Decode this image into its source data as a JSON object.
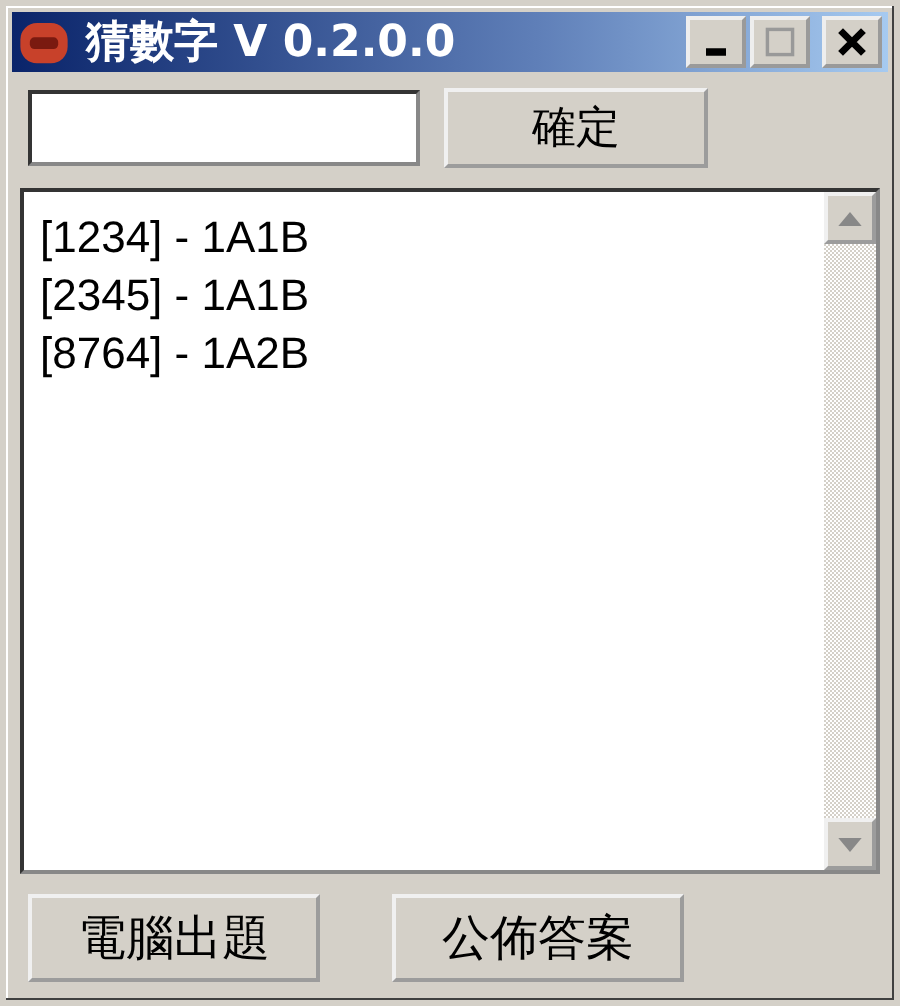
{
  "window": {
    "title": "猜數字 V 0.2.0.0"
  },
  "guess_form": {
    "submit_button": "確定"
  },
  "history": [
    {
      "text": "[1234] - 1A1B"
    },
    {
      "text": "[2345] - 1A1B"
    },
    {
      "text": "[8764] - 1A2B"
    }
  ],
  "buttons": [
    "電腦出題",
    "公佈答案"
  ]
}
